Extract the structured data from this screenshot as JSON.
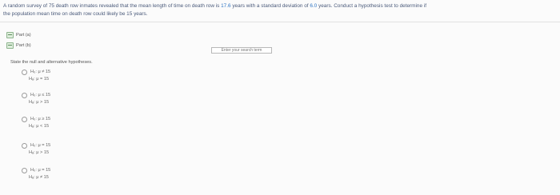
{
  "problem": {
    "line1_a": "A random survey of 75 death row inmates revealed that the mean length of time on death row is ",
    "line1_mean": "17.6",
    "line1_b": " years with a standard deviation of ",
    "line1_sd": "6.0",
    "line1_c": " years. Conduct a hypothesis test to determine if",
    "line2": "the population mean time on death row could likely be 15 years."
  },
  "parts": [
    {
      "label": "Part (a)"
    },
    {
      "label": "Part (b)"
    }
  ],
  "search": {
    "placeholder": "Enter your search term"
  },
  "instruction": "State the null and alternative hypotheses.",
  "options": [
    {
      "h0": "H₀: μ ≠ 15",
      "ha": "Hₐ: μ = 15"
    },
    {
      "h0": "H₀: μ ≤ 15",
      "ha": "Hₐ: μ > 15"
    },
    {
      "h0": "H₀: μ ≥ 15",
      "ha": "Hₐ: μ < 15"
    },
    {
      "h0": "H₀: μ = 15",
      "ha": "Hₐ: μ > 15"
    },
    {
      "h0": "H₀: μ = 15",
      "ha": "Hₐ: μ ≠ 15"
    }
  ]
}
